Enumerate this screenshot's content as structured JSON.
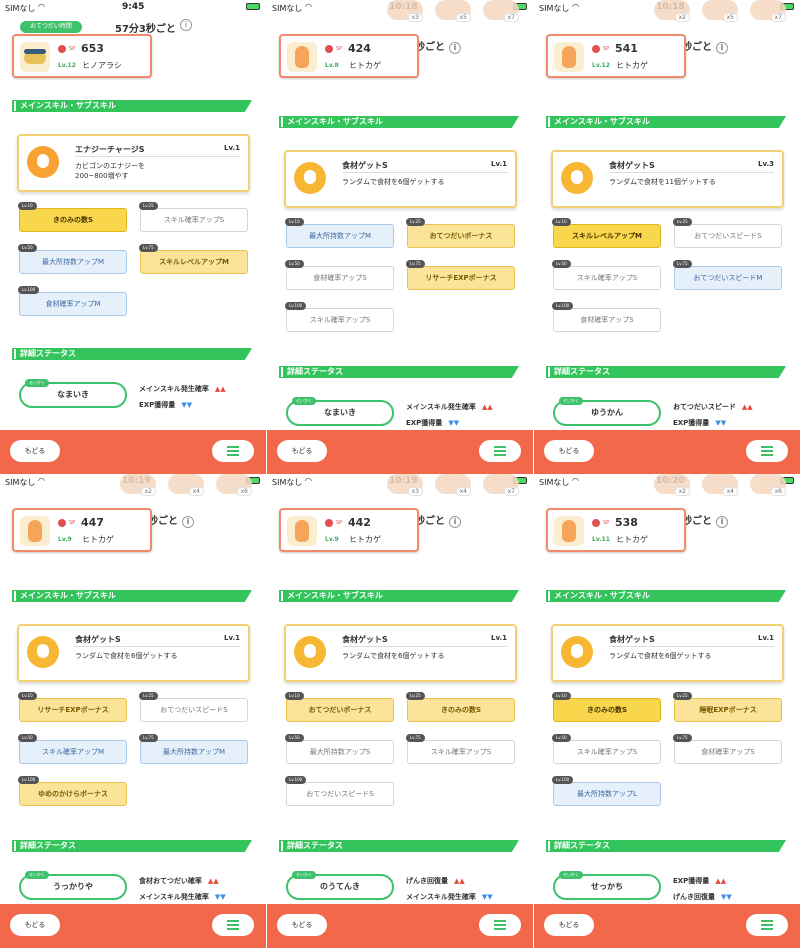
{
  "labels": {
    "main_skill_section": "メインスキル・サブスキル",
    "detail_section": "詳細ステータス",
    "nature_tag": "せいかく",
    "timer_pill": "おてつだい時間",
    "back": "もどる",
    "sp_label": "SP",
    "carrier": "SIMなし"
  },
  "panels": [
    {
      "time": "9:45",
      "timer_text": "57分3秒ごと",
      "partial_text": "",
      "food_counts": [],
      "pokemon": {
        "sp": "653",
        "level": "Lv.12",
        "name": "ヒノアラシ",
        "kind": "cyndaquil"
      },
      "skill": {
        "name": "エナジーチャージS",
        "level": "Lv.1",
        "desc": "カビゴンのエナジーを\n200~800増やす",
        "icon": "flame-icon"
      },
      "subskills": [
        {
          "unlock": "Lv.10",
          "label": "きのみの数S",
          "style": "gold bright"
        },
        {
          "unlock": "Lv.25",
          "label": "スキル確率アップS",
          "style": "white"
        },
        {
          "unlock": "Lv.50",
          "label": "最大所持数アップM",
          "style": "blue"
        },
        {
          "unlock": "Lv.75",
          "label": "スキルレベルアップM",
          "style": "gold"
        },
        {
          "unlock": "Lv.100",
          "label": "食材確率アップM",
          "style": "blue"
        }
      ],
      "nature": "なまいき",
      "up": "メインスキル発生確率",
      "down": "EXP獲得量"
    },
    {
      "time": "10:18",
      "timer_text": "",
      "partial_text": "秒ごと",
      "food_counts": [
        "x3",
        "x5",
        "x7"
      ],
      "pokemon": {
        "sp": "424",
        "level": "Lv.8",
        "name": "ヒトカゲ",
        "kind": "charmander"
      },
      "skill": {
        "name": "食材ゲットS",
        "level": "Lv.1",
        "desc": "ランダムで食材を6個ゲットする",
        "icon": "apple-icon"
      },
      "subskills": [
        {
          "unlock": "Lv.10",
          "label": "最大所持数アップM",
          "style": "blue"
        },
        {
          "unlock": "Lv.25",
          "label": "おてつだいボーナス",
          "style": "gold"
        },
        {
          "unlock": "Lv.50",
          "label": "食材確率アップS",
          "style": "white"
        },
        {
          "unlock": "Lv.75",
          "label": "リサーチEXPボーナス",
          "style": "gold"
        },
        {
          "unlock": "Lv.100",
          "label": "スキル確率アップS",
          "style": "white"
        }
      ],
      "nature": "なまいき",
      "up": "メインスキル発生確率",
      "down": "EXP獲得量"
    },
    {
      "time": "10:18",
      "timer_text": "",
      "partial_text": "秒ごと",
      "food_counts": [
        "x2",
        "x5",
        "x7"
      ],
      "pokemon": {
        "sp": "541",
        "level": "Lv.12",
        "name": "ヒトカゲ",
        "kind": "charmander"
      },
      "skill": {
        "name": "食材ゲットS",
        "level": "Lv.3",
        "desc": "ランダムで食材を11個ゲットする",
        "icon": "apple-icon"
      },
      "subskills": [
        {
          "unlock": "Lv.10",
          "label": "スキルレベルアップM",
          "style": "gold bright"
        },
        {
          "unlock": "Lv.25",
          "label": "おてつだいスピードS",
          "style": "white"
        },
        {
          "unlock": "Lv.50",
          "label": "スキル確率アップS",
          "style": "white"
        },
        {
          "unlock": "Lv.75",
          "label": "おてつだいスピードM",
          "style": "blue"
        },
        {
          "unlock": "Lv.100",
          "label": "食材確率アップS",
          "style": "white"
        }
      ],
      "nature": "ゆうかん",
      "up": "おてつだいスピード",
      "down": "EXP獲得量"
    },
    {
      "time": "10:19",
      "timer_text": "",
      "partial_text": "秒ごと",
      "food_counts": [
        "x2",
        "x4",
        "x6"
      ],
      "pokemon": {
        "sp": "447",
        "level": "Lv.9",
        "name": "ヒトカゲ",
        "kind": "charmander"
      },
      "skill": {
        "name": "食材ゲットS",
        "level": "Lv.1",
        "desc": "ランダムで食材を6個ゲットする",
        "icon": "apple-icon"
      },
      "subskills": [
        {
          "unlock": "Lv.10",
          "label": "リサーチEXPボーナス",
          "style": "gold"
        },
        {
          "unlock": "Lv.25",
          "label": "おてつだいスピードS",
          "style": "white"
        },
        {
          "unlock": "Lv.50",
          "label": "スキル確率アップM",
          "style": "blue"
        },
        {
          "unlock": "Lv.75",
          "label": "最大所持数アップM",
          "style": "blue"
        },
        {
          "unlock": "Lv.100",
          "label": "ゆめのかけらボーナス",
          "style": "gold"
        }
      ],
      "nature": "うっかりや",
      "up": "食材おてつだい確率",
      "down": "メインスキル発生確率"
    },
    {
      "time": "10:19",
      "timer_text": "",
      "partial_text": "秒ごと",
      "food_counts": [
        "x3",
        "x4",
        "x7"
      ],
      "pokemon": {
        "sp": "442",
        "level": "Lv.9",
        "name": "ヒトカゲ",
        "kind": "charmander"
      },
      "skill": {
        "name": "食材ゲットS",
        "level": "Lv.1",
        "desc": "ランダムで食材を6個ゲットする",
        "icon": "apple-icon"
      },
      "subskills": [
        {
          "unlock": "Lv.10",
          "label": "おてつだいボーナス",
          "style": "gold"
        },
        {
          "unlock": "Lv.25",
          "label": "きのみの数S",
          "style": "gold"
        },
        {
          "unlock": "Lv.50",
          "label": "最大所持数アップS",
          "style": "white"
        },
        {
          "unlock": "Lv.75",
          "label": "スキル確率アップS",
          "style": "white"
        },
        {
          "unlock": "Lv.100",
          "label": "おてつだいスピードS",
          "style": "white"
        }
      ],
      "nature": "のうてんき",
      "up": "げんき回復量",
      "down": "メインスキル発生確率"
    },
    {
      "time": "10:20",
      "timer_text": "",
      "partial_text": "秒ごと",
      "food_counts": [
        "x2",
        "x4",
        "x6"
      ],
      "pokemon": {
        "sp": "538",
        "level": "Lv.11",
        "name": "ヒトカゲ",
        "kind": "charmander"
      },
      "skill": {
        "name": "食材ゲットS",
        "level": "Lv.1",
        "desc": "ランダムで食材を6個ゲットする",
        "icon": "apple-icon"
      },
      "subskills": [
        {
          "unlock": "Lv.10",
          "label": "きのみの数S",
          "style": "gold bright"
        },
        {
          "unlock": "Lv.25",
          "label": "睡眠EXPボーナス",
          "style": "gold"
        },
        {
          "unlock": "Lv.50",
          "label": "スキル確率アップS",
          "style": "white"
        },
        {
          "unlock": "Lv.75",
          "label": "食材確率アップS",
          "style": "white"
        },
        {
          "unlock": "Lv.100",
          "label": "最大所持数アップL",
          "style": "blue"
        }
      ],
      "nature": "せっかち",
      "up": "EXP獲得量",
      "down": "げんき回復量"
    }
  ]
}
